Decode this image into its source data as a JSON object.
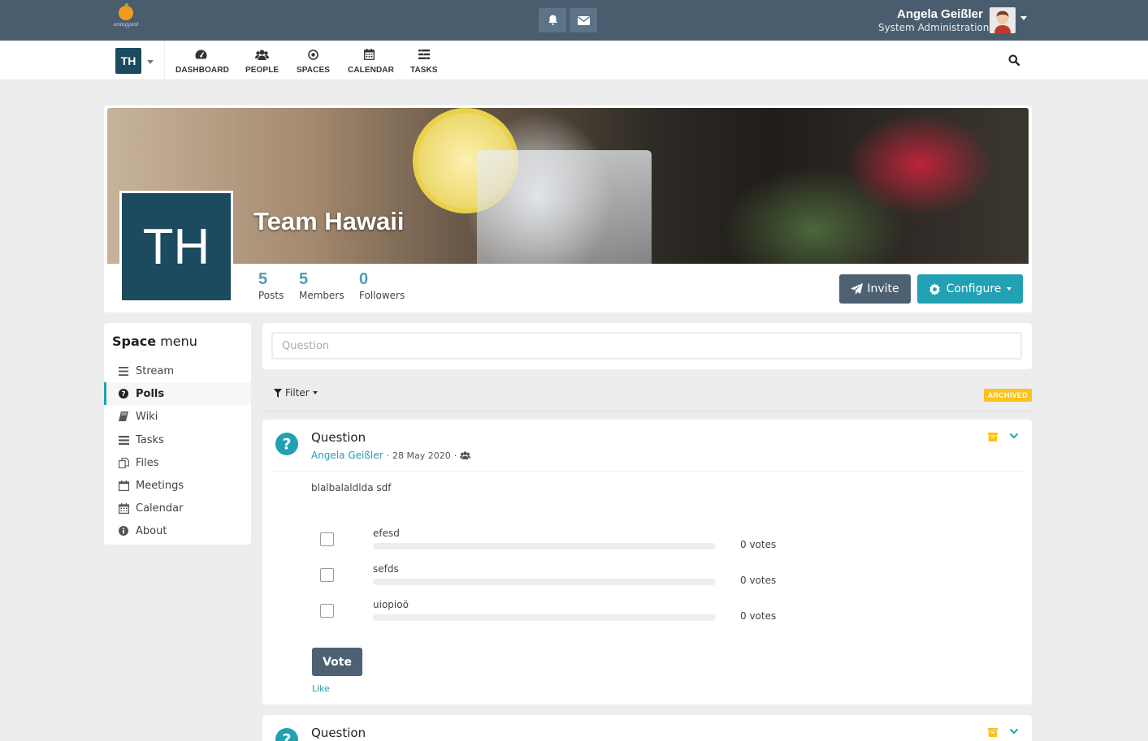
{
  "topbar": {
    "logo_text": "orangyant",
    "user_name": "Angela Geißler",
    "user_role": "System Administration"
  },
  "navbar": {
    "space_chooser_initials": "TH",
    "items": [
      {
        "label": "DASHBOARD",
        "icon": "dashboard-icon"
      },
      {
        "label": "PEOPLE",
        "icon": "people-icon"
      },
      {
        "label": "SPACES",
        "icon": "spaces-icon"
      },
      {
        "label": "CALENDAR",
        "icon": "calendar-icon"
      },
      {
        "label": "TASKS",
        "icon": "tasks-icon"
      }
    ]
  },
  "space": {
    "title": "Team Hawaii",
    "initials": "TH",
    "stats": [
      {
        "value": "5",
        "label": "Posts"
      },
      {
        "value": "5",
        "label": "Members"
      },
      {
        "value": "0",
        "label": "Followers"
      }
    ],
    "invite_label": "Invite",
    "configure_label": "Configure",
    "accent_color": "#21a1b3",
    "dark_color": "#4d6172",
    "space_color": "#1c4a5e"
  },
  "space_menu": {
    "title_bold": "Space",
    "title_rest": " menu",
    "items": [
      {
        "label": "Stream",
        "icon": "stream-icon",
        "active": false
      },
      {
        "label": "Polls",
        "icon": "question-circle-icon",
        "active": true
      },
      {
        "label": "Wiki",
        "icon": "book-icon",
        "active": false
      },
      {
        "label": "Tasks",
        "icon": "tasks-icon",
        "active": false
      },
      {
        "label": "Files",
        "icon": "files-icon",
        "active": false
      },
      {
        "label": "Meetings",
        "icon": "meetings-icon",
        "active": false
      },
      {
        "label": "Calendar",
        "icon": "calendar-icon",
        "active": false
      },
      {
        "label": "About",
        "icon": "info-icon",
        "active": false
      }
    ]
  },
  "create_poll": {
    "placeholder": "Question"
  },
  "filter": {
    "label": "Filter",
    "archived_badge": "ARCHIVED"
  },
  "posts": [
    {
      "title": "Question",
      "author": "Angela Geißler",
      "date": "28 May 2020",
      "description": "blalbalaldlda sdf",
      "answers": [
        {
          "text": "efesd",
          "votes": "0 votes",
          "percent": 0
        },
        {
          "text": "sefds",
          "votes": "0 votes",
          "percent": 0
        },
        {
          "text": "uiopioö",
          "votes": "0 votes",
          "percent": 0
        }
      ],
      "vote_label": "Vote",
      "like_label": "Like"
    },
    {
      "title": "Question"
    }
  ]
}
